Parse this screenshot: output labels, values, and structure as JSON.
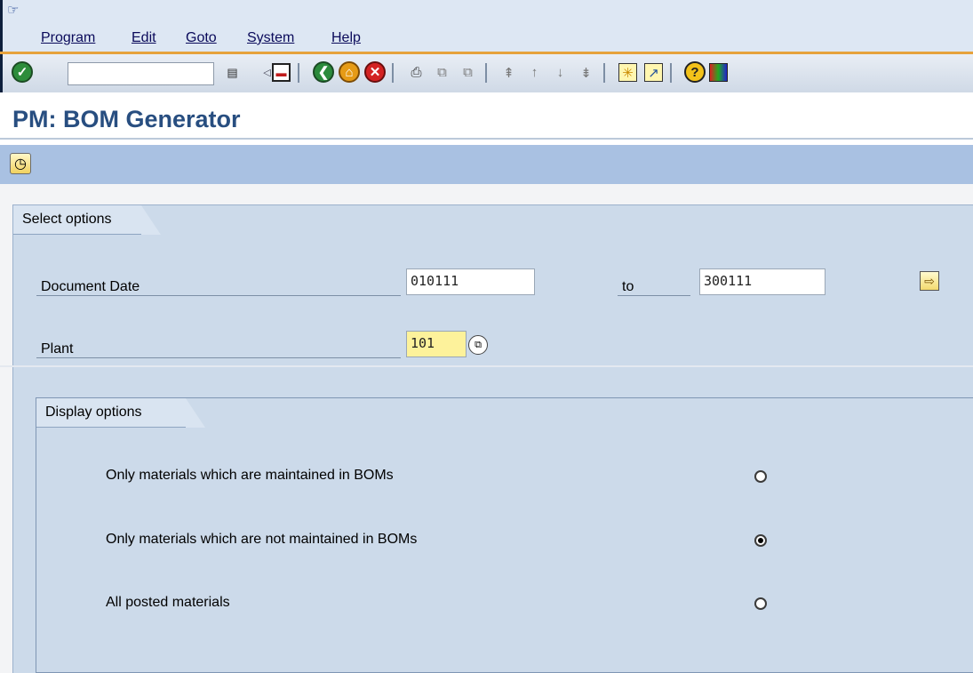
{
  "menu": {
    "items": [
      {
        "label": "Program"
      },
      {
        "label": "Edit"
      },
      {
        "label": "Goto"
      },
      {
        "label": "System"
      },
      {
        "label": "Help"
      }
    ]
  },
  "toolbar": {
    "command_value": ""
  },
  "page": {
    "title": "PM: BOM Generator"
  },
  "select_options": {
    "header": "Select options",
    "document_date": {
      "label": "Document Date",
      "from": "010111",
      "to_label": "to",
      "to": "300111"
    },
    "plant": {
      "label": "Plant",
      "value": "101"
    }
  },
  "display_options": {
    "header": "Display options",
    "options": [
      {
        "label": "Only materials which are maintained in BOMs",
        "selected": false
      },
      {
        "label": "Only materials which are not maintained in BOMs",
        "selected": true
      },
      {
        "label": "All posted materials",
        "selected": false
      }
    ]
  },
  "colors": {
    "menubar_bg": "#dde7f3",
    "apptoolbar_bg": "#a9c1e2",
    "panel_bg": "#ccdaea",
    "title": "#284e80",
    "required_field": "#fdf29b"
  }
}
